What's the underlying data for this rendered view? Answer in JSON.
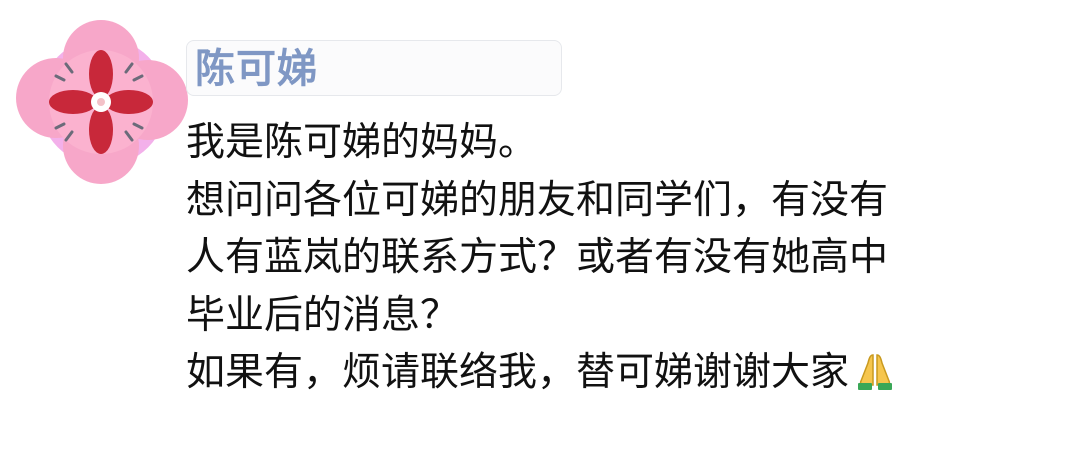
{
  "post": {
    "author_name": "陈可娣",
    "message_lines": [
      "我是陈可娣的妈妈。",
      "想问问各位可娣的朋友和同学们，有没有",
      "人有蓝岚的联系方式？或者有没有她高中",
      "毕业后的消息？",
      "如果有，烦请联络我，替可娣谢谢大家"
    ],
    "trailing_emoji": "praying-hands-icon"
  },
  "colors": {
    "name": "#7f97c4",
    "text": "#111111",
    "avatar_bg": "#f7a7c9",
    "avatar_flower": "#c8283a"
  }
}
